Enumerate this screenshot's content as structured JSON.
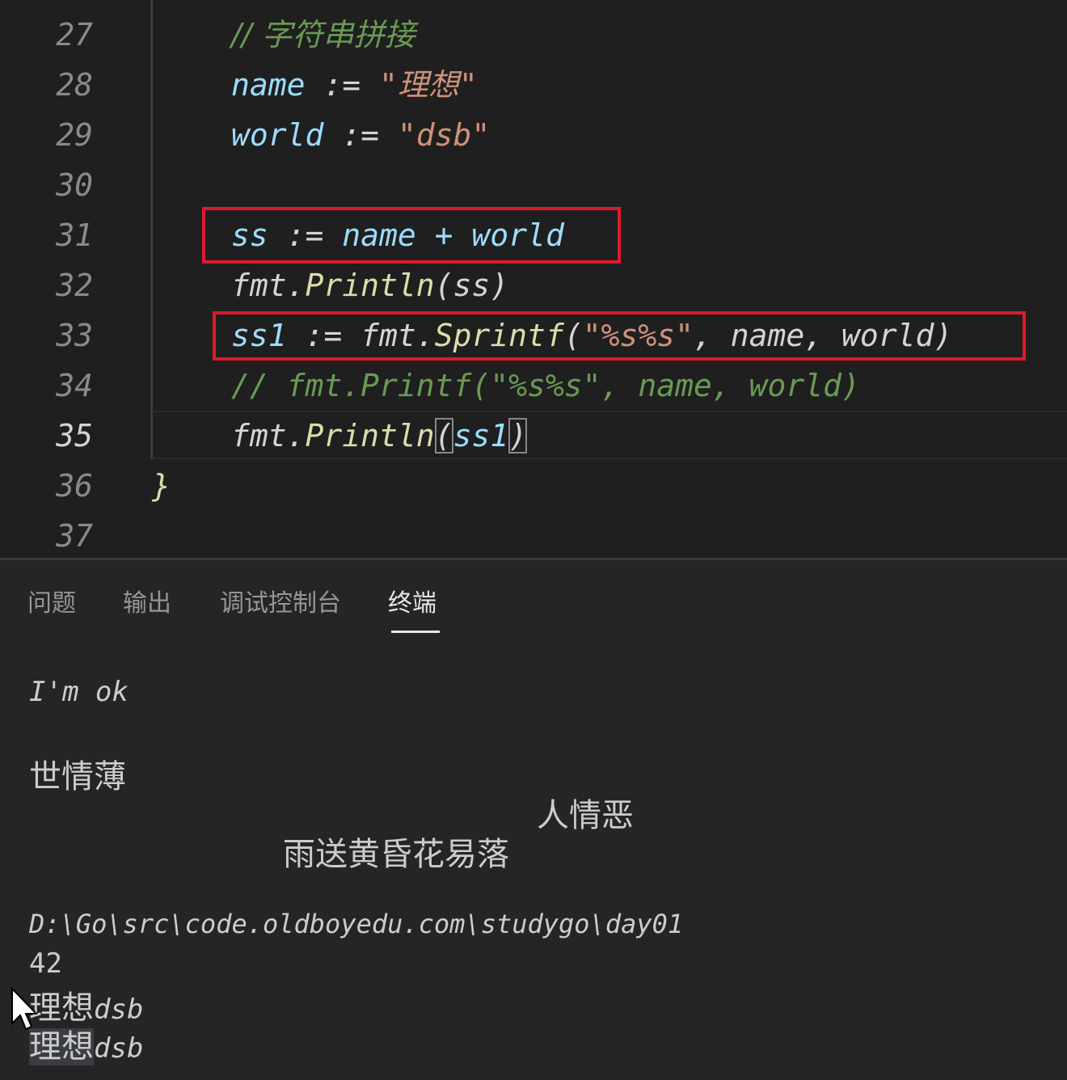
{
  "editor": {
    "lines": [
      {
        "num": "27",
        "comment": "// 字符串拼接"
      },
      {
        "num": "28",
        "var": "name",
        "op": " := ",
        "str": "\"理想\""
      },
      {
        "num": "29",
        "var": "world",
        "op": " := ",
        "str": "\"dsb\""
      },
      {
        "num": "30"
      },
      {
        "num": "31",
        "var": "ss",
        "op": " := ",
        "text": "name + world"
      },
      {
        "num": "32",
        "pkg": "fmt.",
        "fn": "Println",
        "args": "(ss)"
      },
      {
        "num": "33",
        "var": "ss1",
        "op": " := ",
        "pkg": "fmt.",
        "fn": "Sprintf",
        "open": "(",
        "str": "\"%s%s\"",
        "rest": ", name, world)"
      },
      {
        "num": "34",
        "comment": "// fmt.Printf(\"%s%s\", name, world)"
      },
      {
        "num": "35",
        "pkg": "fmt.",
        "fn": "Println",
        "open": "(",
        "arg": "ss1",
        "close": ")"
      },
      {
        "num": "36",
        "brace": "}"
      },
      {
        "num": "37"
      }
    ],
    "active_line": "35"
  },
  "panel": {
    "tabs": [
      {
        "label": "问题",
        "active": false
      },
      {
        "label": "输出",
        "active": false
      },
      {
        "label": "调试控制台",
        "active": false
      },
      {
        "label": "终端",
        "active": true
      }
    ]
  },
  "terminal": {
    "line1": "I'm ok",
    "line2": "世情薄",
    "line3": "人情恶",
    "line4": "雨送黄昏花易落",
    "path": "D:\\Go\\src\\code.oldboyedu.com\\studygo\\day01",
    "num": "42",
    "out1_cjk": "理想",
    "out1_ascii": "dsb",
    "out2_cjk": "理想",
    "out2_ascii": "dsb"
  },
  "colors": {
    "highlight_box": "#e0182d",
    "comment": "#6a9955",
    "variable": "#9cdcfe",
    "string": "#ce9178",
    "function": "#dcdcaa"
  }
}
